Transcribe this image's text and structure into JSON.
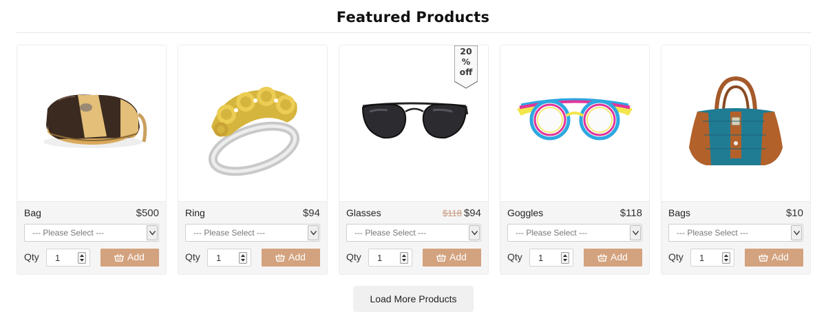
{
  "section_title": "Featured Products",
  "select_placeholder": "--- Please Select ---",
  "qty_label": "Qty",
  "add_label": "Add",
  "load_more_label": "Load More Products",
  "colors": {
    "add_button": "#d3a27e",
    "old_price": "#c99a82",
    "card_bg": "#f5f5f5"
  },
  "products": [
    {
      "name": "Bag",
      "price": "$500",
      "qty": "1",
      "image_icon": "bag-image"
    },
    {
      "name": "Ring",
      "price": "$94",
      "qty": "1",
      "image_icon": "ring-image"
    },
    {
      "name": "Glasses",
      "price": "$94",
      "old_price": "$118",
      "qty": "1",
      "image_icon": "sunglasses-image",
      "badge": "20\n%\noff"
    },
    {
      "name": "Goggles",
      "price": "$118",
      "qty": "1",
      "image_icon": "goggles-image"
    },
    {
      "name": "Bags",
      "price": "$10",
      "qty": "1",
      "image_icon": "handbag-image"
    }
  ]
}
